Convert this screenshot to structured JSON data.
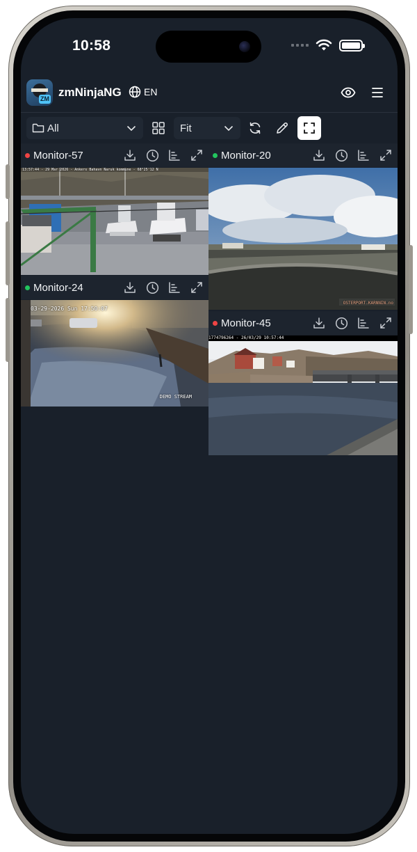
{
  "status_bar": {
    "time": "10:58"
  },
  "header": {
    "app_name": "zmNinjaNG",
    "logo_badge": "ZM",
    "language": "EN"
  },
  "toolbar": {
    "group_select": "All",
    "fit_select": "Fit"
  },
  "monitors": [
    {
      "name": "Monitor-57",
      "status_color": "#ef4444",
      "osd": "13:57:44 - 29 Mar 2026 - Ankers Bahavn Naruk kommune - 68°25'12 N",
      "osd_right": ""
    },
    {
      "name": "Monitor-20",
      "status_color": "#22c55e",
      "osd": "",
      "osd_right": "OSTERPORT.KARNNIN.no"
    },
    {
      "name": "Monitor-24",
      "status_color": "#22c55e",
      "osd": "03-29-2026 Sun 17:50:07",
      "osd_right": "DEMO STREAM"
    },
    {
      "name": "Monitor-45",
      "status_color": "#ef4444",
      "osd": "1774796264 - 26/03/29 10:57:44",
      "osd_right": ""
    }
  ],
  "colors": {
    "screen_bg": "#19202a",
    "bar_bg": "#1d242e",
    "accent_active": "#ffffff"
  }
}
